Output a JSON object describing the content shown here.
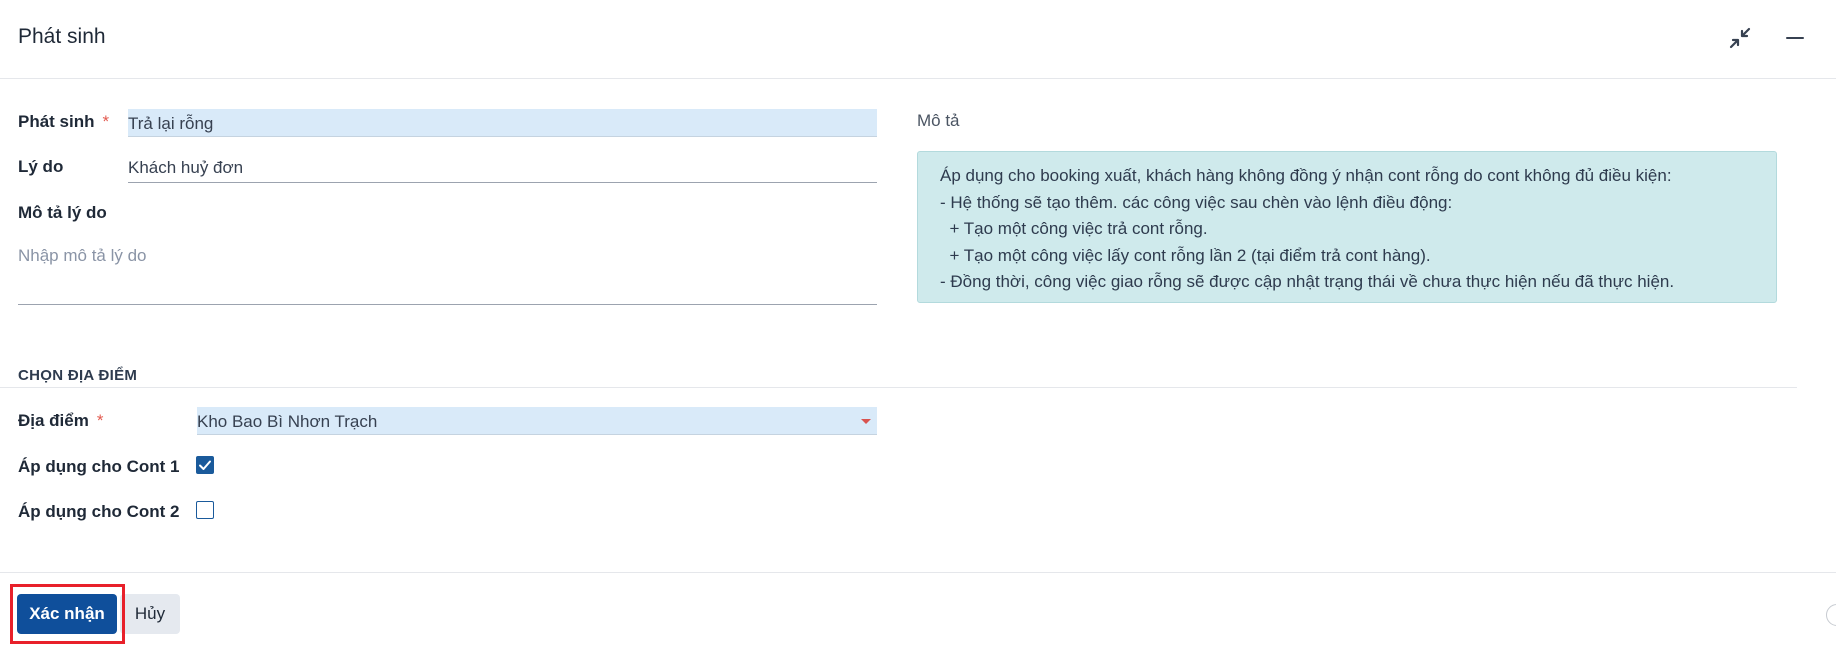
{
  "dialog": {
    "title": "Phát sinh",
    "icons": {
      "collapse": "collapse-arrows-icon",
      "minimize": "minimize-icon"
    }
  },
  "form": {
    "phat_sinh": {
      "label": "Phát sinh",
      "required_mark": "*",
      "value": "Trả lại rỗng"
    },
    "ly_do": {
      "label": "Lý do",
      "value": "Khách huỷ đơn"
    },
    "mo_ta_ly_do": {
      "label": "Mô tả lý do",
      "placeholder": "Nhập mô tả lý do"
    }
  },
  "description": {
    "title": "Mô tả",
    "lines": [
      "Áp dụng cho booking xuất, khách hàng không đồng ý nhận cont rỗng do cont không đủ điều kiện:",
      "- Hệ thống sẽ tạo thêm. các công việc sau chèn vào lệnh điều động:",
      "  + Tạo một công việc trả cont rỗng.",
      "  + Tạo một công việc lấy cont rỗng lần 2 (tại điểm trả cont hàng).",
      "- Đồng thời, công việc giao rỗng sẽ được cập nhật trạng thái về chưa thực hiện nếu đã thực hiện."
    ]
  },
  "location_section": {
    "title": "CHỌN ĐỊA ĐIỂM",
    "dia_diem": {
      "label": "Địa điểm",
      "required_mark": "*",
      "value": "Kho Bao Bì Nhơn Trạch"
    },
    "cont1": {
      "label": "Áp dụng cho Cont 1",
      "checked": true
    },
    "cont2": {
      "label": "Áp dụng cho Cont 2",
      "checked": false
    }
  },
  "footer": {
    "confirm_label": "Xác nhận",
    "cancel_label": "Hủy"
  },
  "colors": {
    "primary": "#0f4f9b",
    "input_highlight": "#d9eaf9",
    "info_box": "#cfeaec",
    "required": "#e25a4f",
    "annotation_frame": "#e8202a"
  }
}
